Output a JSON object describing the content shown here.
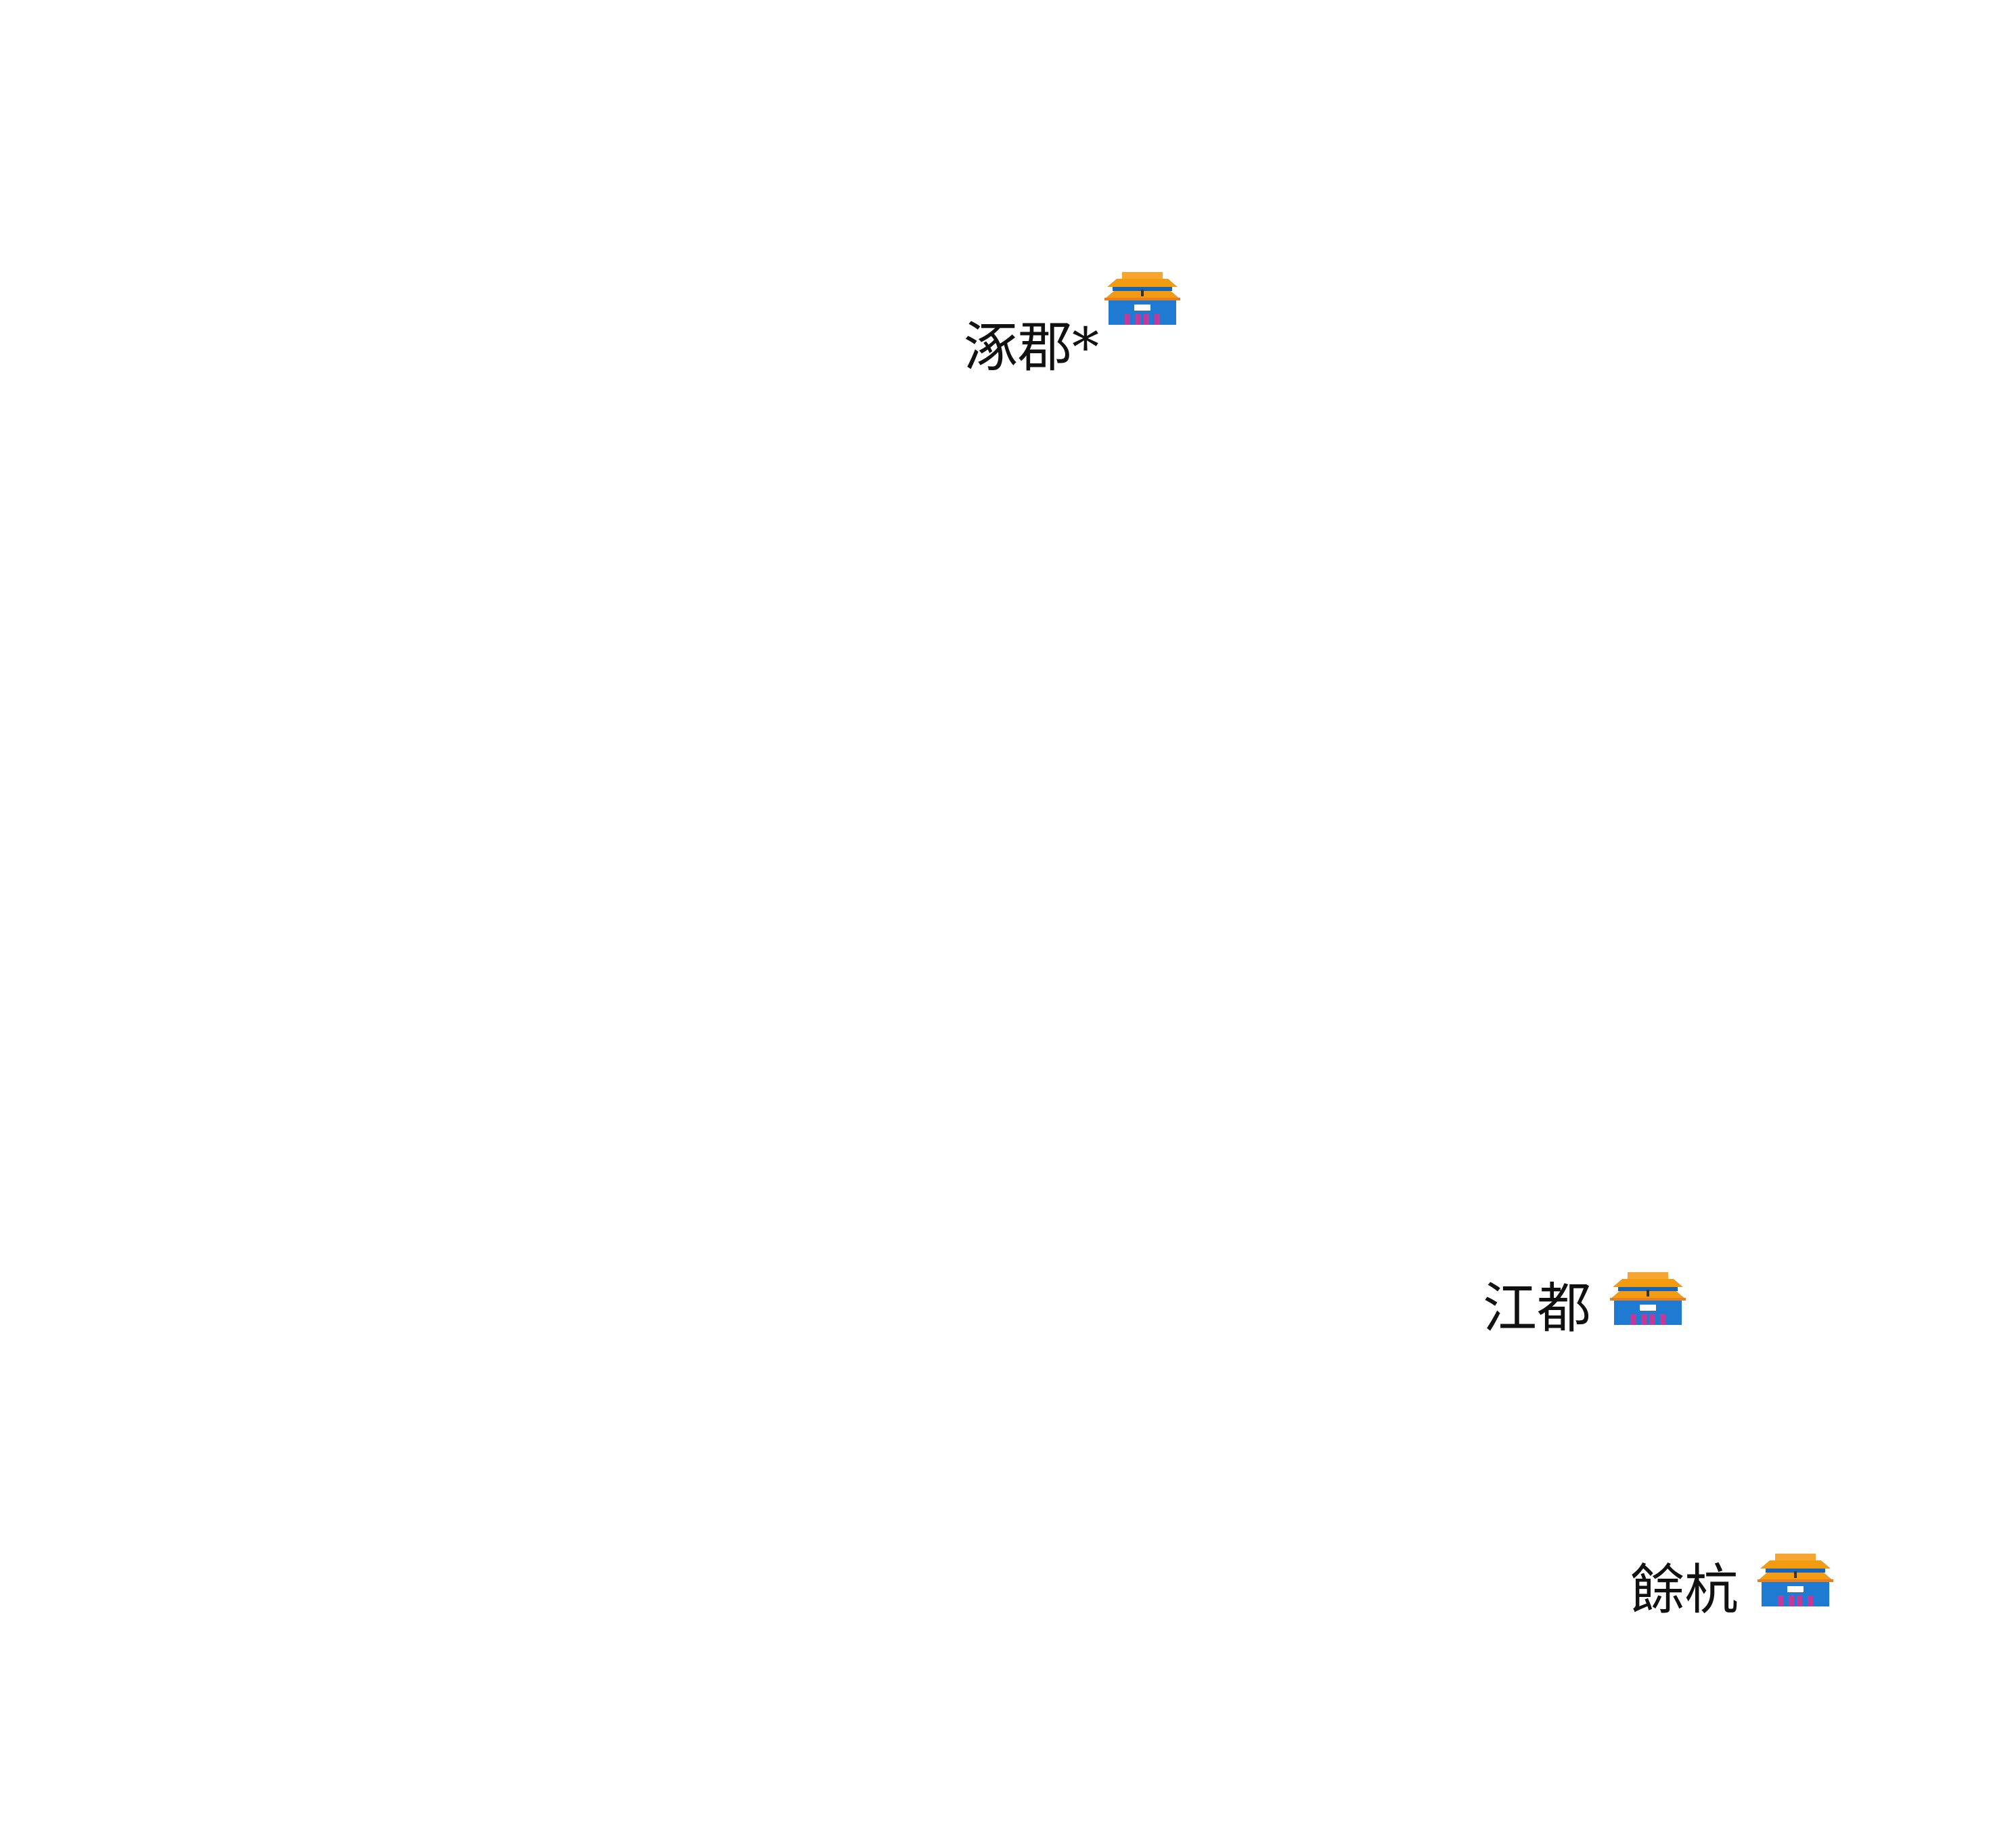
{
  "map": {
    "background_color": "#ffffff",
    "cities": [
      {
        "name": "涿郡*",
        "icon": "palace-icon"
      },
      {
        "name": "江都",
        "icon": "palace-icon"
      },
      {
        "name": "餘杭",
        "icon": "palace-icon"
      }
    ]
  },
  "colors": {
    "roof": "#f39c12",
    "roof_dark": "#e67e22",
    "wall": "#1f7bd1",
    "door": "#c0399b",
    "sign": "#ffffff",
    "text": "#111111"
  }
}
